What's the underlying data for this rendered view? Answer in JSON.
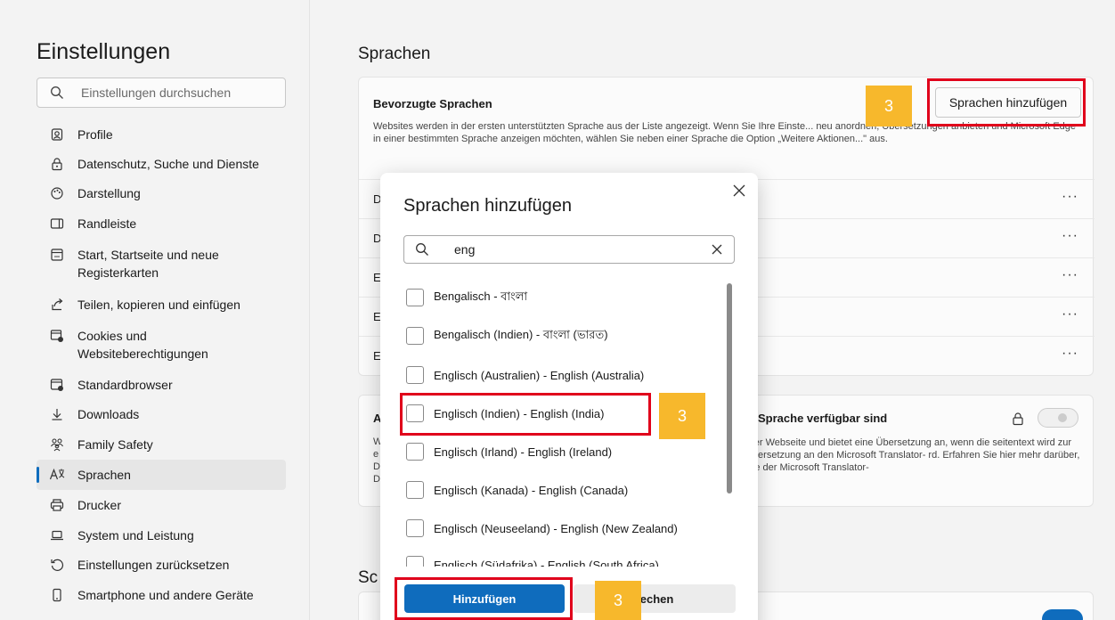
{
  "sidebar": {
    "title": "Einstellungen",
    "search_placeholder": "Einstellungen durchsuchen",
    "items": [
      {
        "label": "Profile",
        "icon": "profile-icon"
      },
      {
        "label": "Datenschutz, Suche und Dienste",
        "icon": "lock-icon"
      },
      {
        "label": "Darstellung",
        "icon": "appearance-icon"
      },
      {
        "label": "Randleiste",
        "icon": "sidebar-icon"
      },
      {
        "label": "Start, Startseite und neue Registerkarten",
        "icon": "home-tabs-icon"
      },
      {
        "label": "Teilen, kopieren und einfügen",
        "icon": "share-icon"
      },
      {
        "label": "Cookies und Websiteberechtigungen",
        "icon": "cookies-icon"
      },
      {
        "label": "Standardbrowser",
        "icon": "default-browser-icon"
      },
      {
        "label": "Downloads",
        "icon": "download-icon"
      },
      {
        "label": "Family Safety",
        "icon": "family-icon"
      },
      {
        "label": "Sprachen",
        "icon": "languages-icon"
      },
      {
        "label": "Drucker",
        "icon": "printer-icon"
      },
      {
        "label": "System und Leistung",
        "icon": "laptop-icon"
      },
      {
        "label": "Einstellungen zurücksetzen",
        "icon": "reset-icon"
      },
      {
        "label": "Smartphone und andere Geräte",
        "icon": "phone-icon"
      }
    ]
  },
  "main": {
    "title": "Sprachen",
    "preferred": {
      "heading": "Bevorzugte Sprachen",
      "add_button": "Sprachen hinzufügen",
      "description": "Websites werden in der ersten unterstützten Sprache aus der Liste angezeigt. Wenn Sie Ihre Einste... neu anordnen, Übersetzungen anbieten und Microsoft Edge in einer bestimmten Sprache anzeigen möchten, wählen Sie neben einer Sprache die Option „Weitere Aktionen...\" aus.",
      "row_letters": [
        "D",
        "D",
        "E",
        "E",
        "E"
      ],
      "more_label": "···"
    },
    "translate": {
      "letter": "A",
      "heading": "Sprache verfügbar sind",
      "description": "hrer Webseite und bietet eine Übersetzung an, wenn die seitentext wird zur Übersetzung an den Microsoft Translator- rd. Erfahren Sie hier mehr darüber, wie der Microsoft Translator-",
      "side_letters": [
        "W",
        "e",
        "D",
        "D"
      ]
    },
    "section_title": "Sc"
  },
  "dialog": {
    "title": "Sprachen hinzufügen",
    "search_value": "eng",
    "options": [
      "Bengalisch - বাংলা",
      "Bengalisch (Indien) - বাংলা (ভারত)",
      "Englisch (Australien) - English (Australia)",
      "Englisch (Indien) - English (India)",
      "Englisch (Irland) - English (Ireland)",
      "Englisch (Kanada) - English (Canada)",
      "Englisch (Neuseeland) - English (New Zealand)",
      "Englisch (Südafrika) - English (South Africa)"
    ],
    "primary_button": "Hinzufügen",
    "secondary_button": "rechen"
  },
  "annotations": {
    "badge_label": "3",
    "highlight_color": "#e0001b",
    "badge_color": "#f7b82c"
  },
  "colors": {
    "accent": "#0f6cbd",
    "background": "#f3f3f3"
  }
}
